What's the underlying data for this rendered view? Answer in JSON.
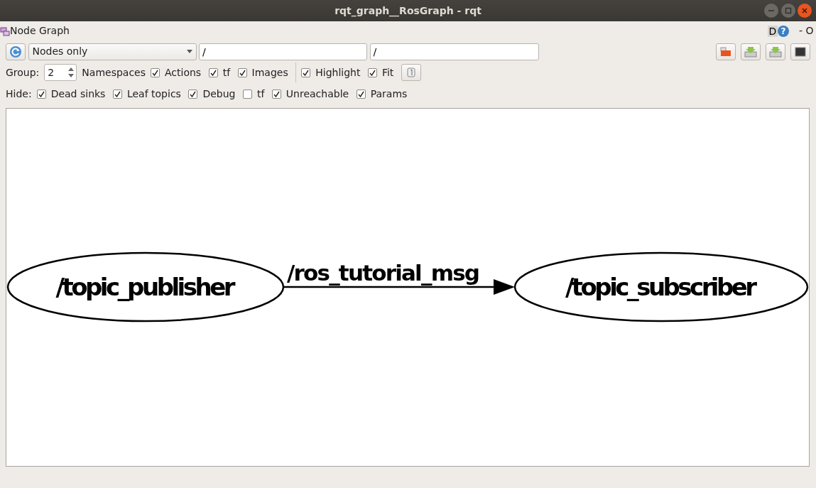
{
  "window": {
    "title": "rqt_graph__RosGraph - rqt"
  },
  "plugin": {
    "title": "Node Graph",
    "d_label": "D",
    "help_glyph": "?",
    "right_marks": "- O"
  },
  "toolbar": {
    "mode": "Nodes only",
    "filter_1": "/",
    "filter_2": "/"
  },
  "options": {
    "group_label": "Group:",
    "group_value": "2",
    "namespaces_label": "Namespaces",
    "checks": [
      {
        "label": "Actions",
        "checked": true
      },
      {
        "label": "tf",
        "checked": true
      },
      {
        "label": "Images",
        "checked": true
      }
    ],
    "checks_2": [
      {
        "label": "Highlight",
        "checked": true
      },
      {
        "label": "Fit",
        "checked": true
      }
    ]
  },
  "hide": {
    "label": "Hide:",
    "checks": [
      {
        "label": "Dead sinks",
        "checked": true
      },
      {
        "label": "Leaf topics",
        "checked": true
      },
      {
        "label": "Debug",
        "checked": true
      },
      {
        "label": "tf",
        "checked": false
      },
      {
        "label": "Unreachable",
        "checked": true
      },
      {
        "label": "Params",
        "checked": true
      }
    ]
  },
  "graph": {
    "nodes": [
      {
        "label": "/topic_publisher"
      },
      {
        "label": "/topic_subscriber"
      }
    ],
    "edges": [
      {
        "label": "/ros_tutorial_msg"
      }
    ]
  }
}
